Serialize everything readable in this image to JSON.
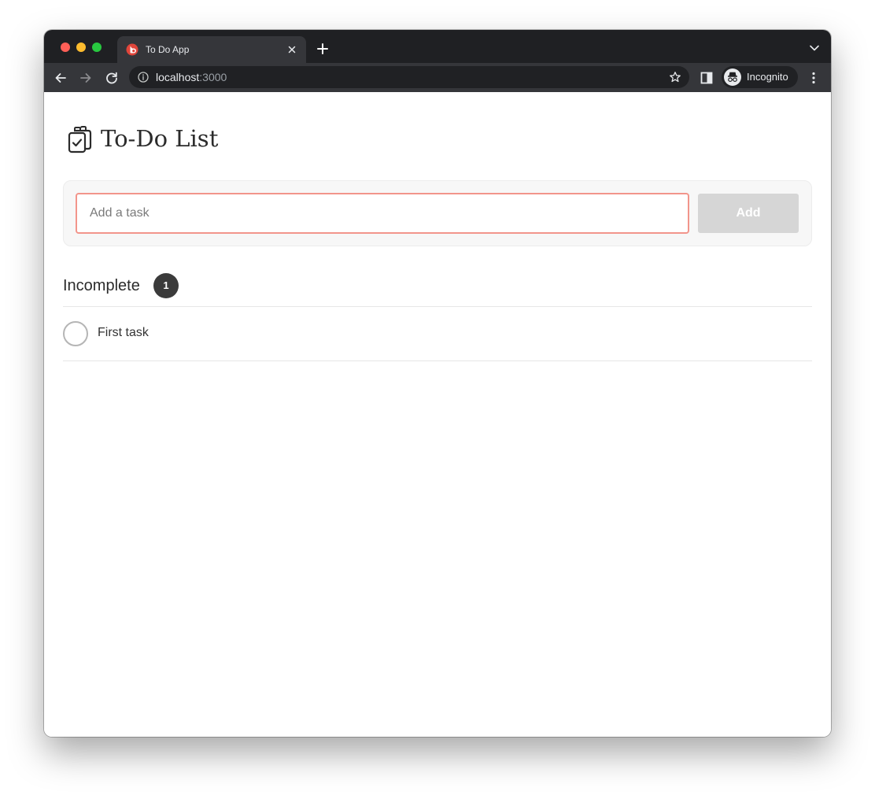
{
  "browser": {
    "tab": {
      "title": "To Do App",
      "favicon": "red-app-icon"
    },
    "omnibox": {
      "host": "localhost",
      "port": ":3000"
    },
    "profile_label": "Incognito"
  },
  "app": {
    "title": "To-Do List",
    "title_icon": "clipboard-check-icon",
    "add_task": {
      "placeholder": "Add a task",
      "value": "",
      "button_label": "Add"
    },
    "sections": [
      {
        "title": "Incomplete",
        "count": "1",
        "tasks": [
          {
            "label": "First task",
            "completed": false
          }
        ]
      }
    ]
  },
  "colors": {
    "input_focus_border": "#f2958b",
    "button_disabled": "#d6d6d6",
    "badge": "#3b3b3b",
    "favicon": "#e0453a"
  }
}
